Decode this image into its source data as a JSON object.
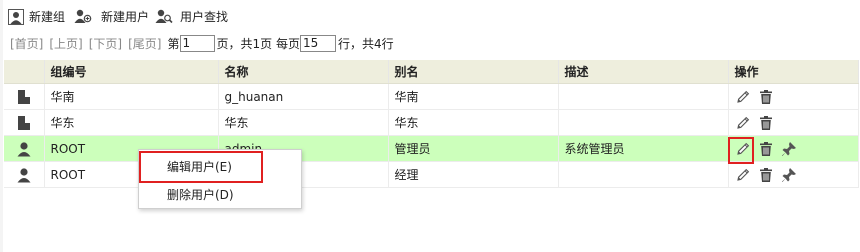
{
  "toolbar": {
    "new_group": "新建组",
    "new_user": "新建用户",
    "user_search": "用户查找"
  },
  "pager": {
    "first": "[首页]",
    "prev": "[上页]",
    "next": "[下页]",
    "last": "[尾页]",
    "page_prefix": "第",
    "page_value": "1",
    "page_suffix": "页，共1页 每页",
    "per_page_value": "15",
    "total_suffix": "行，共4行"
  },
  "table": {
    "headers": [
      "组编号",
      "名称",
      "别名",
      "描述",
      "操作"
    ],
    "rows": [
      {
        "type": "group",
        "id": "华南",
        "name": "g_huanan",
        "alias": "华南",
        "desc": "",
        "has_pin": false
      },
      {
        "type": "group",
        "id": "华东",
        "name": "华东",
        "alias": "华东",
        "desc": "",
        "has_pin": false
      },
      {
        "type": "user",
        "id": "ROOT",
        "name": "admin",
        "alias": "管理员",
        "desc": "系统管理员",
        "has_pin": true
      },
      {
        "type": "user",
        "id": "ROOT",
        "name": "",
        "alias": "经理",
        "desc": "",
        "has_pin": true
      }
    ]
  },
  "context_menu": {
    "edit_user": "编辑用户(E)",
    "delete_user": "删除用户(D)"
  },
  "colors": {
    "selected_row": "#ccffbb",
    "header_bg": "#eeeedd",
    "highlight": "#e02020"
  }
}
